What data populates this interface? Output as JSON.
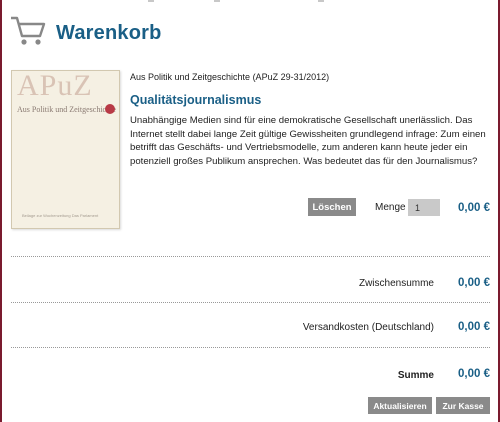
{
  "header": {
    "title": "Warenkorb",
    "icon": "cart-icon"
  },
  "item": {
    "cover": {
      "logo_text": "APuZ",
      "subtitle": "Aus Politik und Zeitgeschichte",
      "footer": "Beilage zur Wochenzeitung Das Parlament"
    },
    "series": "Aus Politik und Zeitgeschichte (APuZ 29-31/2012)",
    "title": "Qualitätsjournalismus",
    "description": "Unabhängige Medien sind für eine demokratische Gesellschaft unerlässlich. Das Internet stellt dabei lange Zeit gültige Gewissheiten grundlegend infrage: Zum einen betrifft das Geschäfts- und Vertriebsmodelle, zum anderen kann heute jeder ein potenziell großes Publikum ansprechen. Was bedeutet das für den Journalismus?",
    "delete_label": "Löschen",
    "quantity_label": "Menge",
    "quantity_value": "1",
    "price": "0,00 €"
  },
  "summary": {
    "subtotal_label": "Zwischensumme",
    "subtotal_value": "0,00 €",
    "shipping_label": "Versandkosten (Deutschland)",
    "shipping_value": "0,00 €",
    "total_label": "Summe",
    "total_value": "0,00 €"
  },
  "actions": {
    "update_label": "Aktualisieren",
    "checkout_label": "Zur Kasse"
  },
  "colors": {
    "accent": "#1a5f86",
    "button": "#8a8a8a",
    "border": "#7a1a2e"
  }
}
